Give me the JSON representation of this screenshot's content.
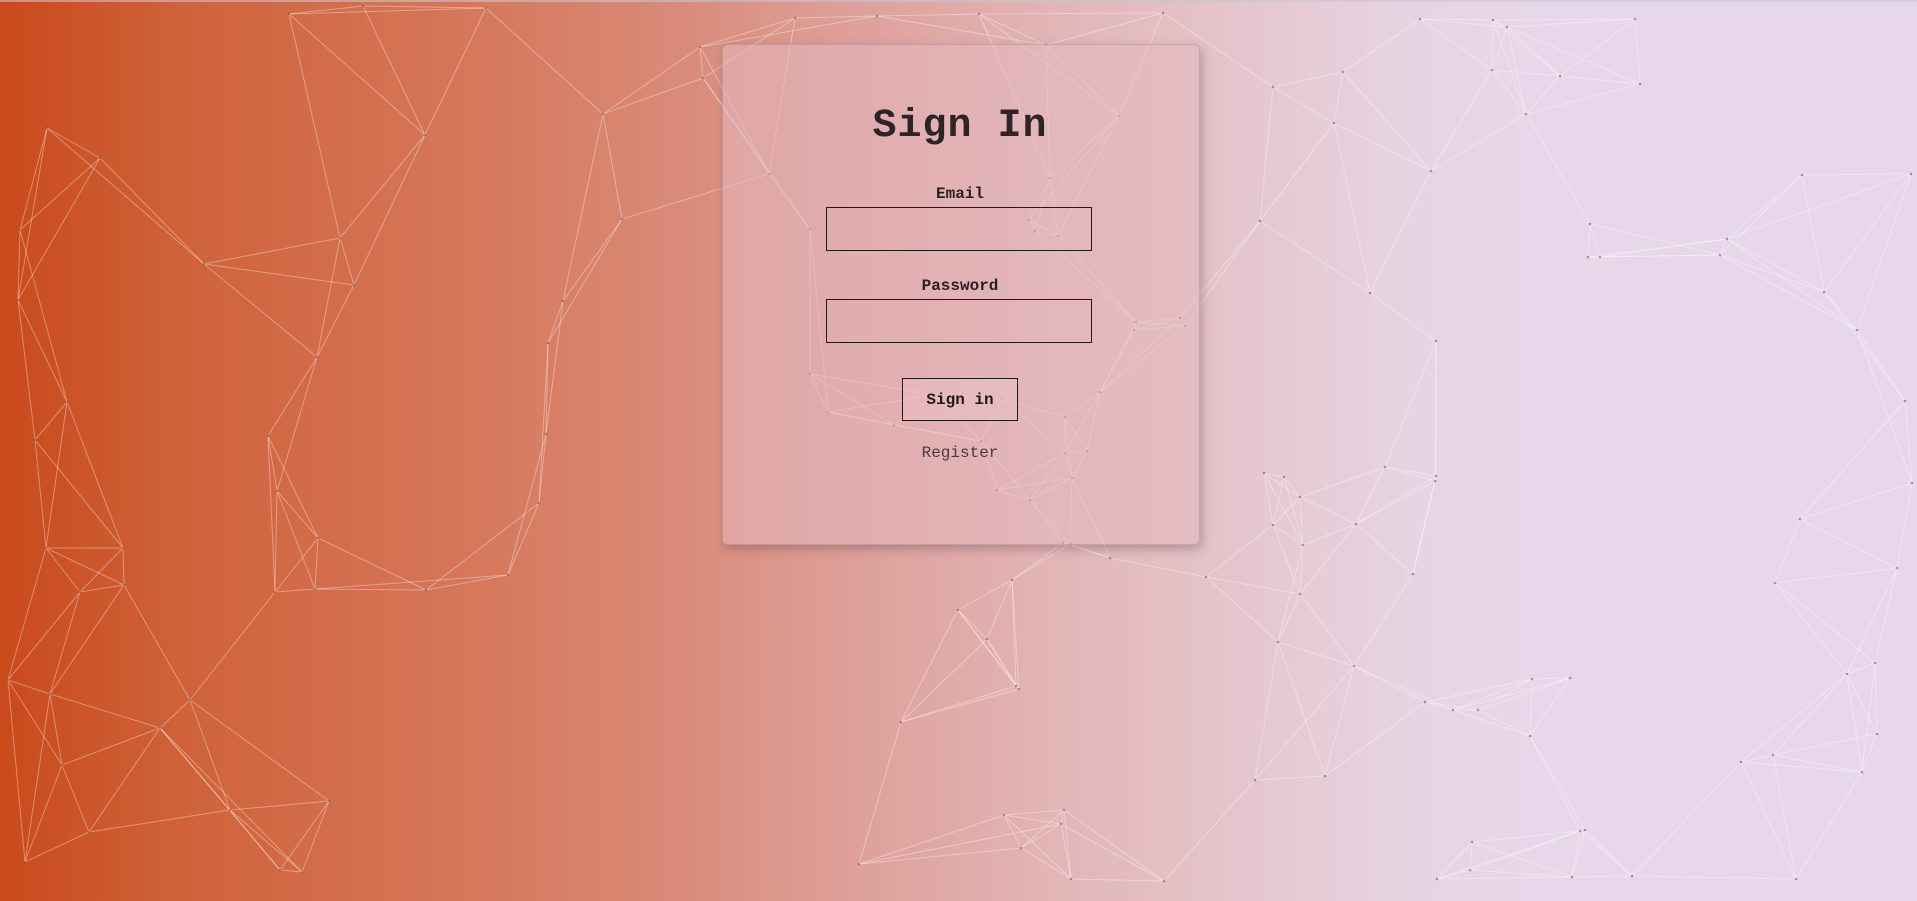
{
  "page": {
    "background_colors": [
      "#c94a1b",
      "#d98a78",
      "#e5c4cb",
      "#e8d7ec"
    ]
  },
  "form": {
    "title": "Sign In",
    "email_label": "Email",
    "email_value": "",
    "password_label": "Password",
    "password_value": "",
    "submit_label": "Sign in",
    "register_label": "Register"
  }
}
